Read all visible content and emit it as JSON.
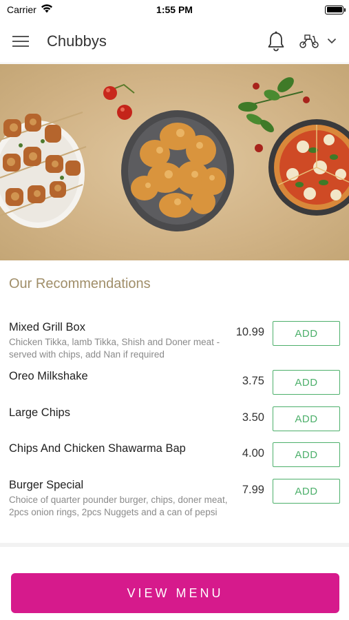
{
  "status_bar": {
    "carrier": "Carrier",
    "time": "1:55 PM",
    "battery_level": 1.0
  },
  "nav": {
    "title": "Chubbys",
    "icons": {
      "menu": "hamburger-menu-icon",
      "notifications": "bell-icon",
      "delivery": "scooter-icon",
      "dropdown": "chevron-down-icon"
    }
  },
  "section": {
    "title": "Our Recommendations"
  },
  "items": [
    {
      "name": "Mixed Grill Box",
      "description": "Chicken Tikka, lamb Tikka, Shish and Doner meat - served with chips, add Nan if required",
      "price": "10.99",
      "add_label": "ADD"
    },
    {
      "name": "Oreo Milkshake",
      "description": "",
      "price": "3.75",
      "add_label": "ADD"
    },
    {
      "name": "Large Chips",
      "description": "",
      "price": "3.50",
      "add_label": "ADD"
    },
    {
      "name": "Chips And Chicken Shawarma Bap",
      "description": "",
      "price": "4.00",
      "add_label": "ADD"
    },
    {
      "name": "Burger Special",
      "description": "Choice of quarter pounder burger, chips, doner meat, 2pcs onion rings, 2pcs Nuggets and a can of pepsi",
      "price": "7.99",
      "add_label": "ADD"
    }
  ],
  "footer": {
    "view_menu_label": "VIEW MENU"
  },
  "colors": {
    "accent": "#d61a8c",
    "add_green": "#4caf6a",
    "section_title": "#a08e69"
  }
}
